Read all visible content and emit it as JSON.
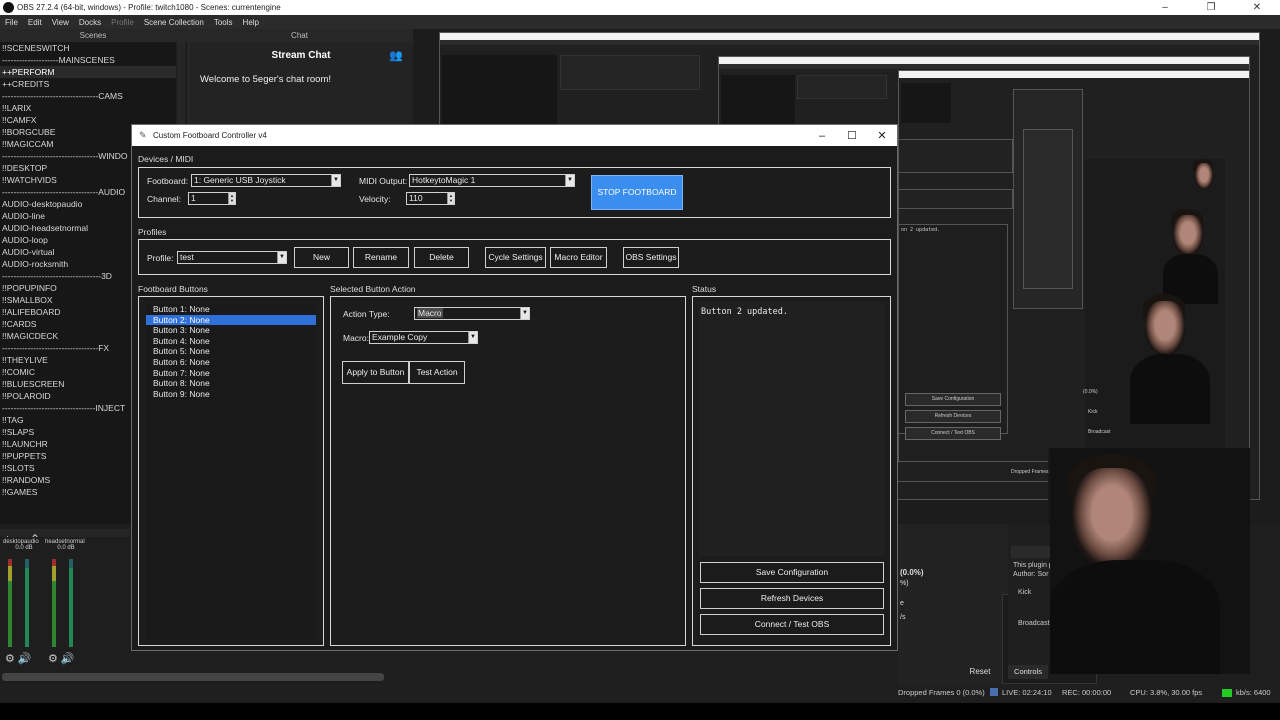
{
  "obs": {
    "title": "OBS 27.2.4 (64-bit, windows) - Profile: twitch1080 - Scenes: currentengine",
    "menu": [
      "File",
      "Edit",
      "View",
      "Docks",
      "Profile",
      "Scene Collection",
      "Tools",
      "Help"
    ],
    "scenes_header": "Scenes",
    "chat_header": "Chat",
    "scenes": [
      "!!SCENESWITCH",
      "--------------------MAINSCENES",
      "++PERFORM",
      "++CREDITS",
      "----------------------------------CAMS",
      "!!LARIX",
      "!!CAMFX",
      "!!BORGCUBE",
      "!!MAGICCAM",
      "----------------------------------WINDO",
      "!!DESKTOP",
      "!!WATCHVIDS",
      "----------------------------------AUDIO",
      "AUDIO-desktopaudio",
      "AUDIO-line",
      "AUDIO-headsetnormal",
      "AUDIO-loop",
      "AUDIO-virtual",
      "AUDIO-rocksmith",
      "-----------------------------------3D",
      "!!POPUPINFO",
      "!!SMALLBOX",
      "!!ALIFEBOARD",
      "!!CARDS",
      "!!MAGICDECK",
      "----------------------------------FX",
      "!!THEYLIVE",
      "!!COMIC",
      "!!BLUESCREEN",
      "!!POLAROID",
      "---------------------------------INJECT",
      "!!TAG",
      "!!SLAPS",
      "!!LAUNCHR",
      "!!PUPPETS",
      "!!SLOTS",
      "!!RANDOMS",
      "!!GAMES"
    ],
    "selected_scene_index": 2,
    "mixer": [
      {
        "name": "desktopaudio",
        "db": "0.0 dB"
      },
      {
        "name": "headsetnormal",
        "db": "0.0 dB"
      }
    ],
    "chat": {
      "title": "Stream Chat",
      "welcome": "Welcome to 5eger's chat room!"
    },
    "reset_label": "Reset",
    "controls_label": "Controls",
    "status": {
      "dropped": "Dropped Frames 0 (0.0%)",
      "live": "LIVE: 02:24:10",
      "rec": "REC: 00:00:00",
      "cpu": "CPU: 3.8%, 30.00 fps",
      "kbps": "kb/s: 6400"
    },
    "right_panel": {
      "pct": "(0.0%)",
      "pct2": "%)",
      "plugin": "This plugin p",
      "author": "Author: Sor",
      "kick": "Kick",
      "broadcast": "Broadcast"
    },
    "preview_texts": {
      "updated": "on 2 updated.",
      "save": "Save Configuration",
      "refresh": "Refresh Devices",
      "connect": "Connect / Test OBS",
      "pct": "(0.0%)",
      "kick": "Kick",
      "broadcast": "Broadcast"
    }
  },
  "dialog": {
    "title": "Custom Footboard Controller v4",
    "sections": {
      "devices": "Devices / MIDI",
      "profiles": "Profiles",
      "buttons": "Footboard Buttons",
      "action": "Selected Button Action",
      "status": "Status"
    },
    "devices": {
      "footboard_label": "Footboard:",
      "footboard_value": "1: Generic USB Joystick",
      "channel_label": "Channel:",
      "channel_value": "1",
      "midi_output_label": "MIDI Output:",
      "midi_output_value": "HotkeytoMagic 1",
      "velocity_label": "Velocity:",
      "velocity_value": "110",
      "stop_button": "STOP FOOTBOARD"
    },
    "profiles": {
      "profile_label": "Profile:",
      "profile_value": "test",
      "new": "New",
      "rename": "Rename",
      "delete": "Delete",
      "cycle": "Cycle Settings",
      "macro_editor": "Macro Editor",
      "obs_settings": "OBS Settings"
    },
    "buttons": [
      "Button 1: None",
      "Button 2: None",
      "Button 3: None",
      "Button 4: None",
      "Button 5: None",
      "Button 6: None",
      "Button 7: None",
      "Button 8: None",
      "Button 9: None"
    ],
    "selected_button_index": 1,
    "action": {
      "type_label": "Action Type:",
      "type_value": "Macro",
      "macro_label": "Macro:",
      "macro_value": "Example Copy",
      "apply": "Apply to Button",
      "test": "Test Action"
    },
    "status": {
      "log": "Button 2 updated.",
      "save": "Save Configuration",
      "refresh": "Refresh Devices",
      "connect": "Connect / Test OBS"
    }
  }
}
